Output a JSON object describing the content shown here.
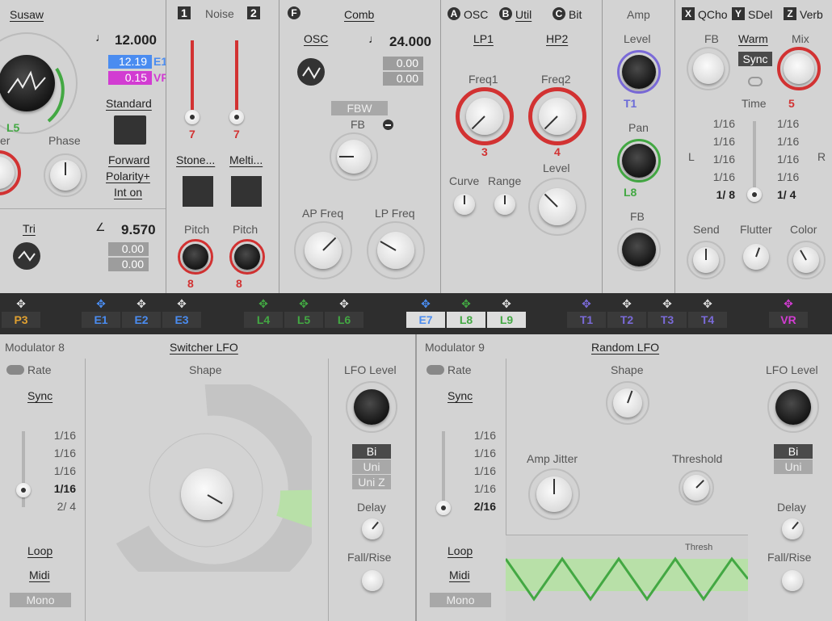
{
  "osc": {
    "title": "Susaw",
    "coarse": "12.000",
    "e1": "12.19",
    "e1_tag": "E1",
    "vr": "0.15",
    "vr_tag": "VR",
    "l5": "L5",
    "phase": "Phase",
    "partial_left": "er",
    "mode": "Standard",
    "forward": "Forward",
    "polarity": "Polarity+",
    "int": "Int on",
    "tri": "Tri",
    "tri_val": "9.570",
    "tri_a": "0.00",
    "tri_b": "0.00"
  },
  "noise": {
    "title": "Noise",
    "n1": "1",
    "n2": "2",
    "v1": "7",
    "v2": "7",
    "stone": "Stone...",
    "melt": "Melti...",
    "pitch1": "Pitch",
    "pitch2": "Pitch",
    "p1": "8",
    "p2": "8"
  },
  "comb": {
    "f": "F",
    "title": "Comb",
    "osc": "OSC",
    "coarse": "24.000",
    "a": "0.00",
    "b": "0.00",
    "fbw": "FBW",
    "fb": "FB",
    "ap": "AP Freq",
    "lp": "LP Freq"
  },
  "filt": {
    "a": "A",
    "osc": "OSC",
    "b": "B",
    "util": "Util",
    "c": "C",
    "bit": "Bit",
    "lp1": "LP1",
    "hp2": "HP2",
    "freq1": "Freq1",
    "freq2": "Freq2",
    "v3": "3",
    "v4": "4",
    "curve": "Curve",
    "range": "Range",
    "level": "Level"
  },
  "amp": {
    "title": "Amp",
    "level": "Level",
    "t1": "T1",
    "pan": "Pan",
    "l8": "L8",
    "fb": "FB"
  },
  "fx": {
    "x": "X",
    "qcho": "QCho",
    "y": "Y",
    "sdel": "SDel",
    "z": "Z",
    "verb": "Verb",
    "fb": "FB",
    "warm": "Warm",
    "mix": "Mix",
    "sync": "Sync",
    "time": "Time",
    "time_val": "5",
    "l": "L",
    "r": "R",
    "left_rates": [
      "1/16",
      "1/16",
      "1/16",
      "1/16",
      "1/ 8"
    ],
    "right_rates": [
      "1/16",
      "1/16",
      "1/16 ",
      "1/16",
      "1/ 4"
    ],
    "send": "Send",
    "flutter": "Flutter",
    "color": "Color"
  },
  "strip": [
    "P3",
    "E1",
    "E2",
    "E3",
    "L4",
    "L5",
    "L6",
    "E7",
    "L8",
    "L9",
    "T1",
    "T2",
    "T3",
    "T4",
    "VR"
  ],
  "mod8": {
    "title": "Modulator 8",
    "type": "Switcher LFO",
    "rate": "Rate",
    "sync": "Sync",
    "rates": [
      "1/16",
      "1/16",
      "1/16",
      "1/16",
      "2/ 4"
    ],
    "loop": "Loop",
    "midi": "Midi",
    "mono": "Mono",
    "shape": "Shape",
    "lfo_level": "LFO Level",
    "bi": "Bi",
    "uni": "Uni",
    "uniz": "Uni Z",
    "delay": "Delay",
    "fall": "Fall/Rise"
  },
  "mod9": {
    "title": "Modulator 9",
    "type": "Random LFO",
    "rate": "Rate",
    "sync": "Sync",
    "rates": [
      "1/16",
      "1/16",
      "1/16",
      "1/16",
      "2/16"
    ],
    "loop": "Loop",
    "midi": "Midi",
    "mono": "Mono",
    "shape": "Shape",
    "jitter": "Amp Jitter",
    "threshold": "Threshold",
    "thresh": "Thresh",
    "lfo_level": "LFO Level",
    "bi": "Bi",
    "uni": "Uni",
    "delay": "Delay",
    "fall": "Fall/Rise"
  },
  "colors": {
    "red": "#d23232",
    "green": "#43a843",
    "blue": "#4a8cf0",
    "purple": "#7a6ad8",
    "magenta": "#d23cd2",
    "orange": "#e0a030"
  }
}
